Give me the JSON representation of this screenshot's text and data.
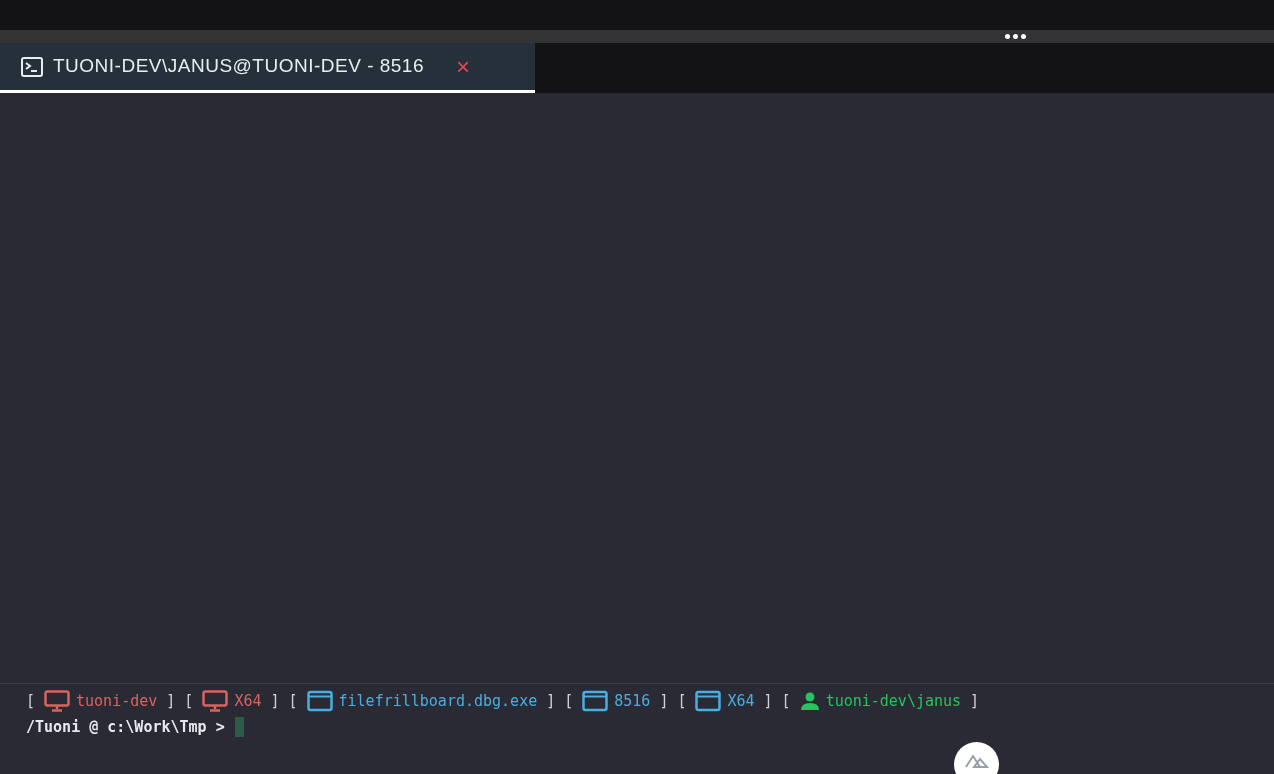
{
  "tabs": [
    {
      "title": "TUONI-DEV\\JANUS@TUONI-DEV - 8516",
      "close": "×",
      "selected": true
    }
  ],
  "status_segments": [
    {
      "open": "[",
      "kind": "monitor",
      "label": "tuoni-dev",
      "color": "#d9635f",
      "close": "]"
    },
    {
      "open": "[",
      "kind": "monitor",
      "label": "X64",
      "color": "#d9635f",
      "close": "]"
    },
    {
      "open": "[",
      "kind": "window",
      "label": "filefrillboard.dbg.exe",
      "color": "#4aaee0",
      "close": "]"
    },
    {
      "open": "[",
      "kind": "window",
      "label": "8516",
      "color": "#4aaee0",
      "close": "]"
    },
    {
      "open": "[",
      "kind": "window",
      "label": "X64",
      "color": "#4aaee0",
      "close": "]"
    },
    {
      "open": "[",
      "kind": "user",
      "label": "tuoni-dev\\janus",
      "color": "#22c55e",
      "close": "]"
    }
  ],
  "prompt": {
    "text": "/Tuoni @ c:\\Work\\Tmp >",
    "cursor": true
  }
}
